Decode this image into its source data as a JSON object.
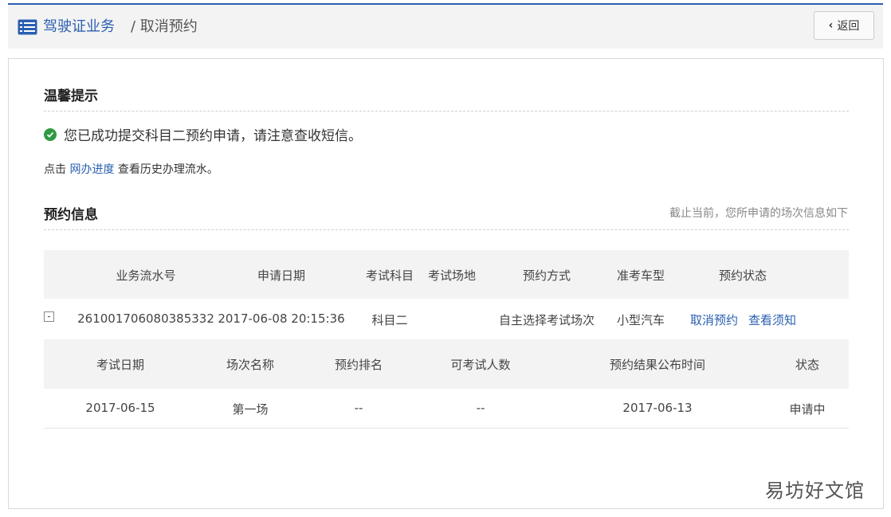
{
  "header": {
    "breadcrumb_link": "驾驶证业务",
    "breadcrumb_current": "/ 取消预约",
    "back_label": "返回",
    "list_icon": "list-icon",
    "accent_color": "#2a5fb0"
  },
  "tip_section": {
    "title": "温馨提示",
    "success_icon": "check-circle-icon",
    "success_message": "您已成功提交科目二预约申请，请注意查收短信。",
    "hint_prefix": "点击",
    "hint_link": "网办进度",
    "hint_suffix": "查看历史办理流水。"
  },
  "booking_section": {
    "title": "预约信息",
    "note": "截止当前，您所申请的场次信息如下",
    "columns": [
      "业务流水号",
      "申请日期",
      "考试科目",
      "考试场地",
      "预约方式",
      "准考车型",
      "预约状态"
    ],
    "row": {
      "toggle": "-",
      "serial": "261001706080385332",
      "apply_date": "2017-06-08 20:15:36",
      "subject": "科目二",
      "venue": "",
      "method": "自主选择考试场次",
      "vehicle": "小型汽车",
      "actions": [
        "取消预约",
        "查看须知"
      ]
    },
    "sub_columns": [
      "考试日期",
      "场次名称",
      "预约排名",
      "可考试人数",
      "预约结果公布时间",
      "状态"
    ],
    "sub_row": {
      "exam_date": "2017-06-15",
      "session": "第一场",
      "rank": "--",
      "capacity": "--",
      "publish_date": "2017-06-13",
      "status": "申请中"
    }
  },
  "watermark": "易坊好文馆"
}
